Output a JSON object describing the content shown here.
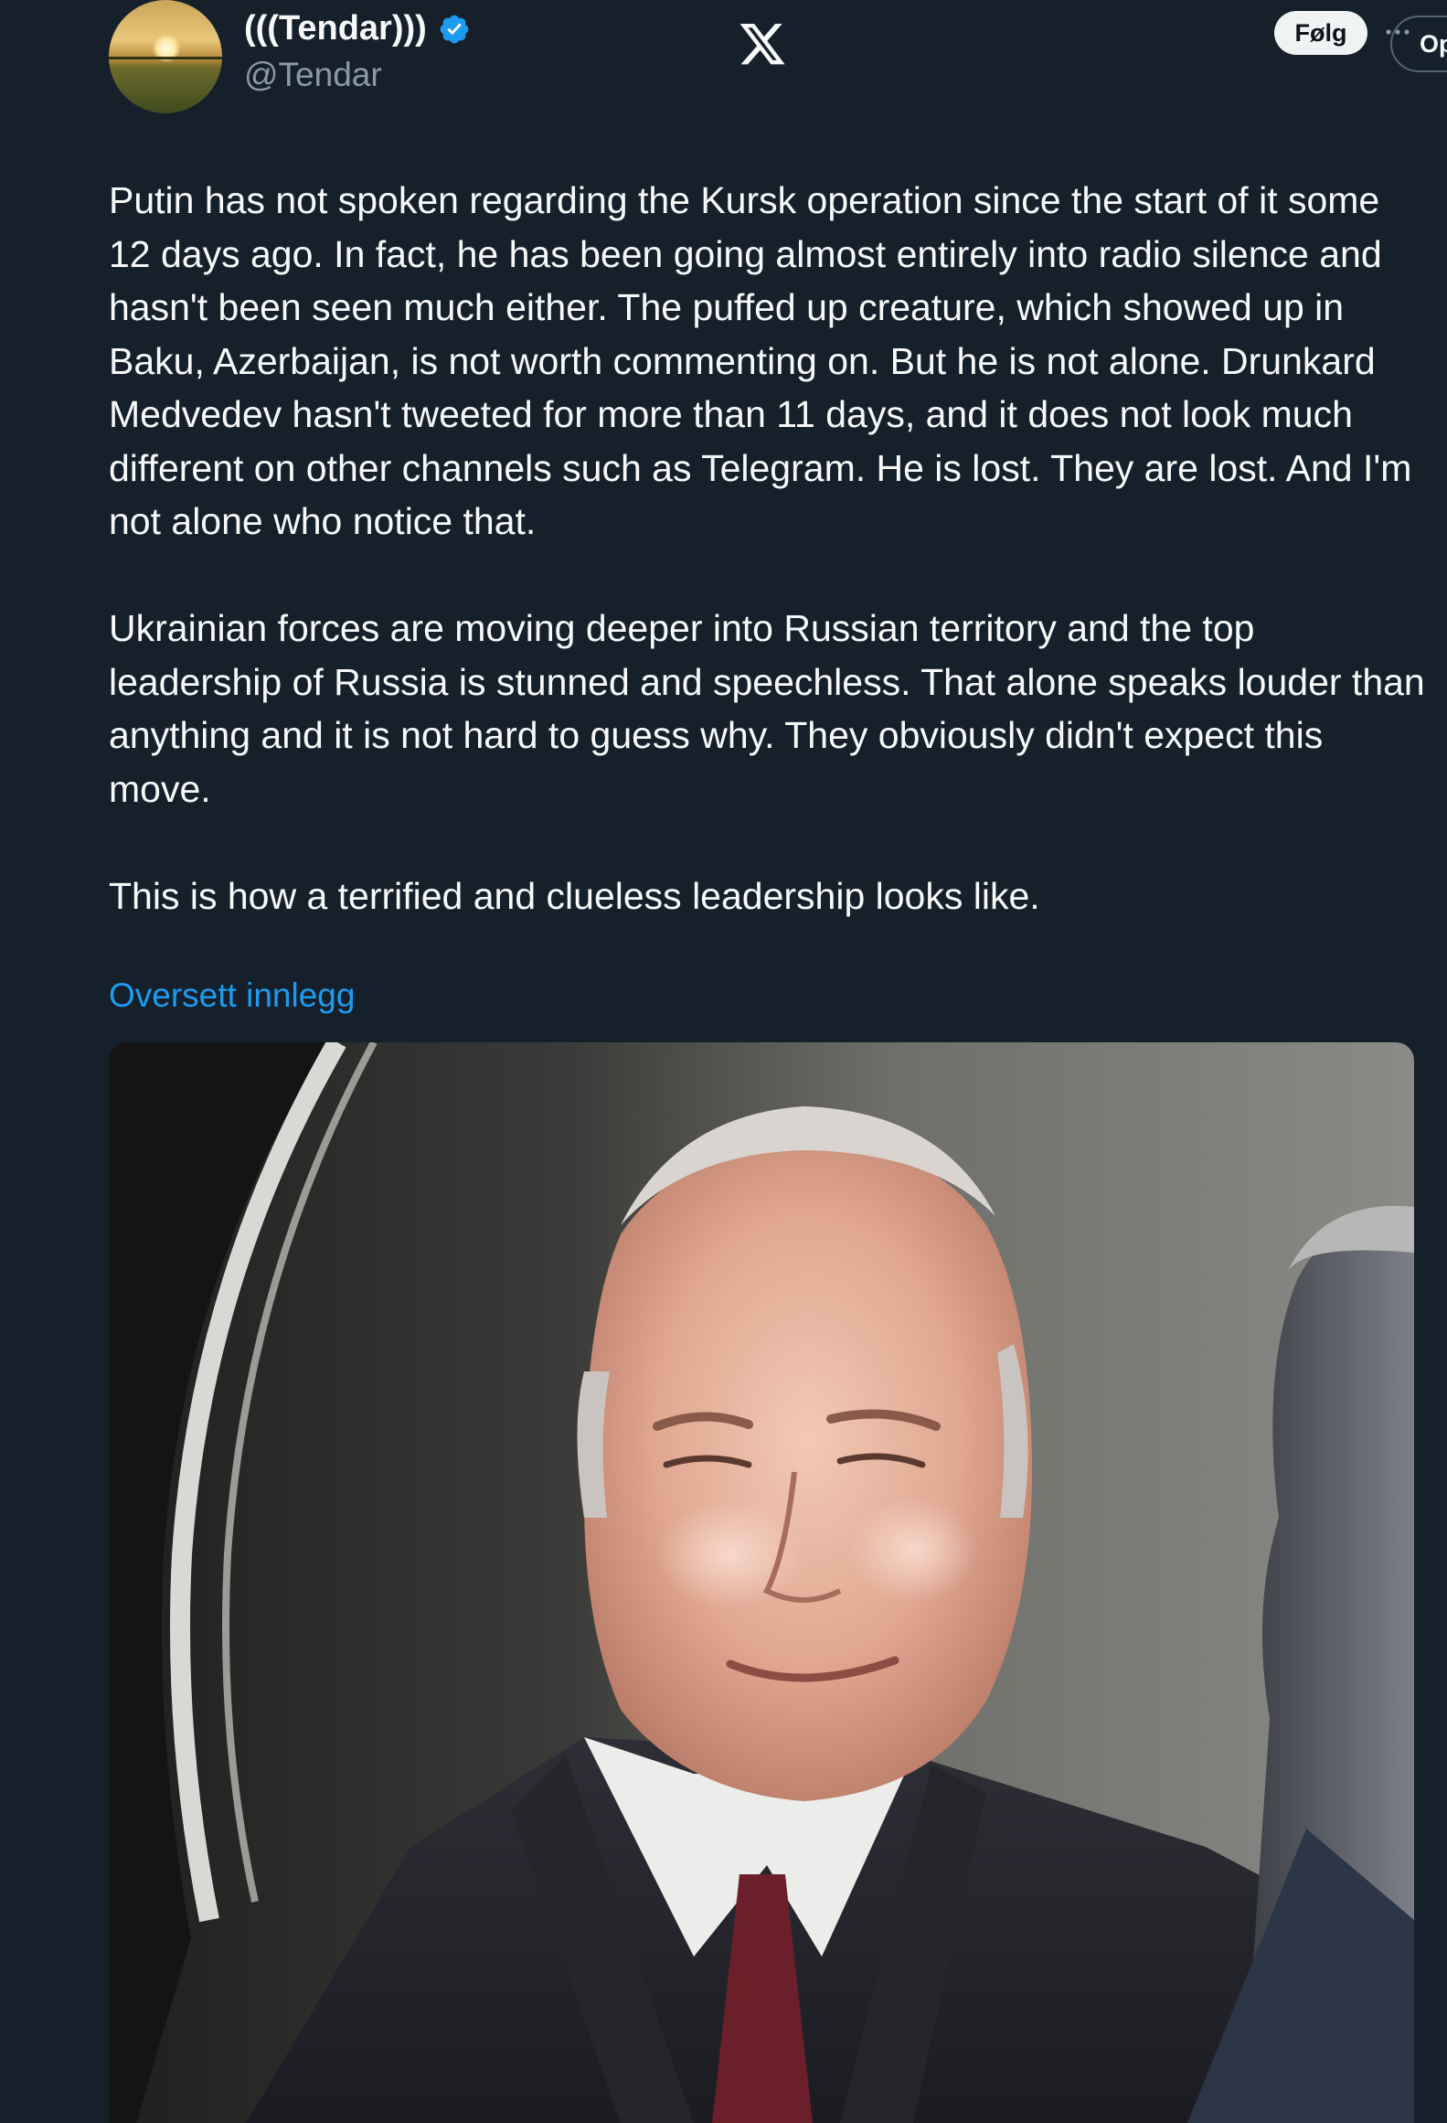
{
  "author": {
    "display_name": "(((Tendar)))",
    "handle": "@Tendar",
    "verified": true
  },
  "header": {
    "logo_icon": "x-logo-icon",
    "follow_label": "Følg",
    "more_icon": "more-dots-icon",
    "open_label": "Op"
  },
  "tweet": {
    "paragraphs": [
      "Putin has not spoken regarding the Kursk operation since the start of it some 12 days ago. In fact, he has been going almost entirely into radio silence and hasn't been seen much either. The puffed up creature, which showed up in Baku, Azerbaijan, is not worth commenting on. But he is not alone. Drunkard Medvedev hasn't tweeted for more than 11 days, and it does not look much different on other channels such as Telegram. He is lost. They are lost. And I'm not alone who notice that.",
      "Ukrainian forces are moving deeper into Russian territory and the top leadership of Russia is stunned and speechless. That alone speaks louder than anything and it is not hard to guess why. They obviously didn't expect this move.",
      "This is how a terrified and clueless leadership looks like."
    ],
    "translate_label": "Oversett innlegg"
  },
  "colors": {
    "background": "#15202b",
    "text": "#f7f9f9",
    "secondary_text": "#8b98a5",
    "link": "#1d9bf0",
    "verified_badge": "#1d9bf0"
  }
}
